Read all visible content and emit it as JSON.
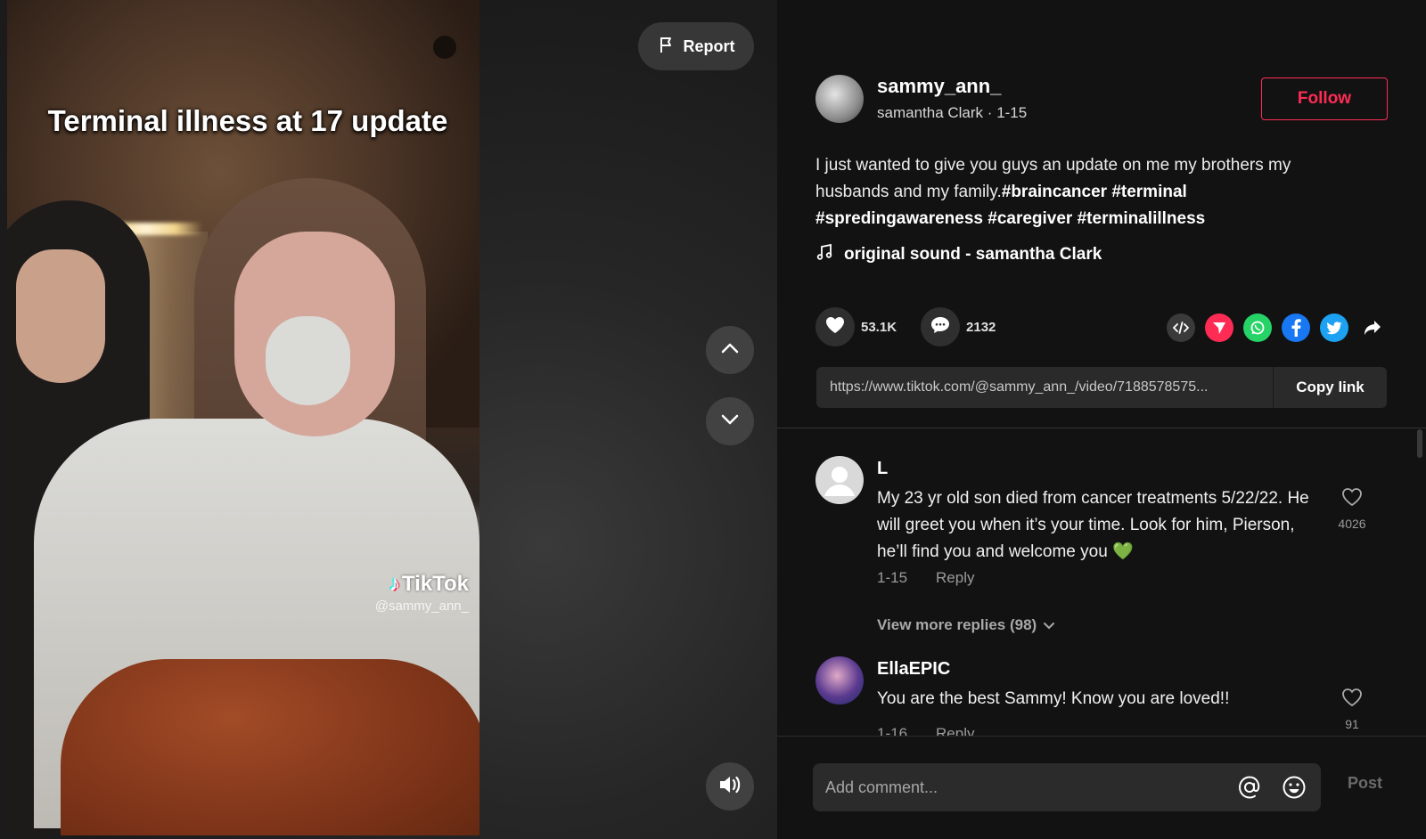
{
  "video": {
    "caption": "Terminal illness at 17 update",
    "watermark_brand": "TikTok",
    "watermark_handle": "@sammy_ann_",
    "report_label": "Report",
    "nav_up_icon": "chevron-up-icon",
    "nav_down_icon": "chevron-down-icon",
    "volume_icon": "volume-icon"
  },
  "author": {
    "username": "sammy_ann_",
    "display_name": "samantha Clark",
    "date": "1-15",
    "follow_label": "Follow"
  },
  "post": {
    "description": "I just wanted to give you guys an update on me my brothers my husbands and my family.",
    "hashtags": "#braincancer #terminal #spredingawareness #caregiver #terminalillness",
    "sound": "original sound - samantha Clark"
  },
  "stats": {
    "likes": "53.1K",
    "comments": "2132"
  },
  "share": {
    "icons": [
      "embed-icon",
      "send-icon",
      "whatsapp-icon",
      "facebook-icon",
      "twitter-icon",
      "share-arrow-icon"
    ]
  },
  "link": {
    "url": "https://www.tiktok.com/@sammy_ann_/video/7188578575...",
    "copy_label": "Copy link"
  },
  "comments": [
    {
      "author": "L",
      "text": "My 23 yr old son died from cancer treatments 5/22/22. He will greet you when it’s your time. Look for him, Pierson, he’ll find you and welcome you 💚",
      "date": "1-15",
      "reply_label": "Reply",
      "likes": "4026"
    },
    {
      "author": "EllaEPIC",
      "text": "You are the best Sammy! Know you are loved!!",
      "date": "1-16",
      "reply_label": "Reply",
      "likes": "91"
    }
  ],
  "more_replies": "View more replies (98)",
  "composer": {
    "placeholder": "Add comment...",
    "post_label": "Post"
  },
  "colors": {
    "accent": "#fe2c55",
    "background": "#121212"
  }
}
